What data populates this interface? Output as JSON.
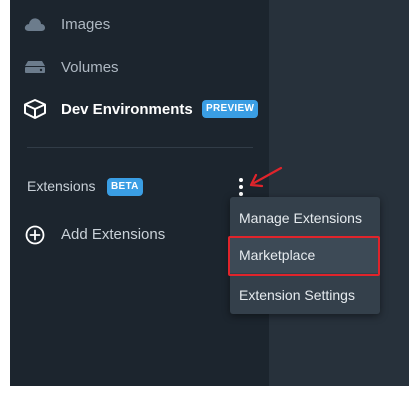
{
  "sidebar": {
    "items": [
      {
        "label": "Images",
        "icon": "cloud-icon"
      },
      {
        "label": "Volumes",
        "icon": "drive-icon"
      },
      {
        "label": "Dev Environments",
        "icon": "cube-icon",
        "badge": "PREVIEW"
      }
    ],
    "extensions": {
      "label": "Extensions",
      "badge": "BETA",
      "add_label": "Add Extensions"
    }
  },
  "menu": {
    "items": [
      {
        "label": "Manage Extensions"
      },
      {
        "label": "Marketplace",
        "highlighted": true
      },
      {
        "label": "Extension Settings"
      }
    ]
  },
  "colors": {
    "sidebar_bg": "#1c252e",
    "main_bg": "#27313b",
    "badge": "#3a9ee4",
    "highlight_box": "#e0242b",
    "annotation_arrow": "#e0242b"
  }
}
